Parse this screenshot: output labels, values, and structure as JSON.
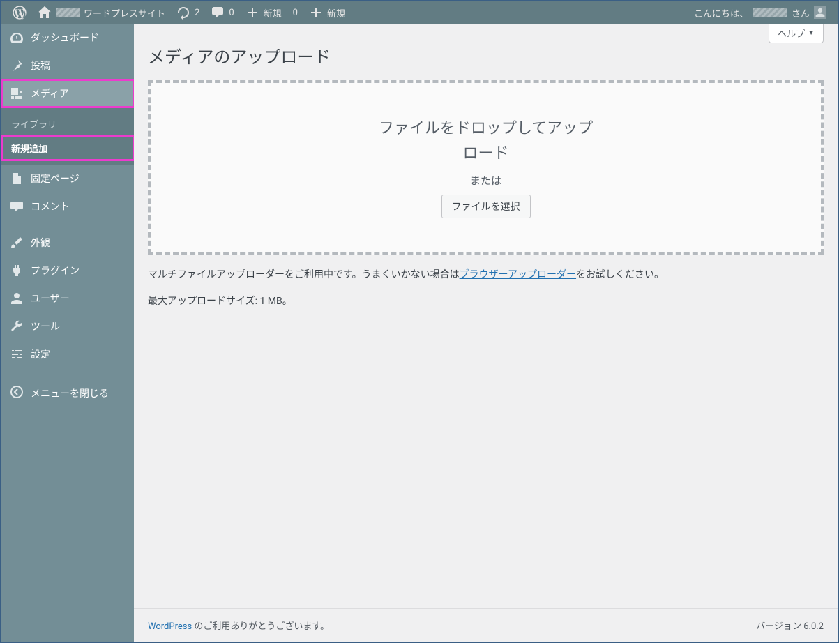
{
  "adminbar": {
    "site_name": "ワードプレスサイト",
    "updates_count": "2",
    "comments_count": "0",
    "new_label": "新規",
    "notif_count": "0",
    "new_button2": "新規",
    "howdy_prefix": "こんにちは、",
    "howdy_suffix": "さん"
  },
  "sidebar": {
    "dashboard": "ダッシュボード",
    "posts": "投稿",
    "media": "メディア",
    "media_sub_library": "ライブラリ",
    "media_sub_addnew": "新規追加",
    "pages": "固定ページ",
    "comments": "コメント",
    "appearance": "外観",
    "plugins": "プラグイン",
    "users": "ユーザー",
    "tools": "ツール",
    "settings": "設定",
    "collapse": "メニューを閉じる"
  },
  "screen": {
    "help_tab": "ヘルプ"
  },
  "page": {
    "title": "メディアのアップロード",
    "drop_message": "ファイルをドロップしてアップロード",
    "or_text": "または",
    "select_button": "ファイルを選択",
    "uploader_note_pre": "マルチファイルアップローダーをご利用中です。うまくいかない場合は",
    "uploader_note_link": "ブラウザーアップローダー",
    "uploader_note_post": "をお試しください。",
    "max_size_text": "最大アップロードサイズ: 1 MB。"
  },
  "footer": {
    "wp_link": "WordPress",
    "thanks_text": " のご利用ありがとうございます。",
    "version": "バージョン 6.0.2"
  }
}
